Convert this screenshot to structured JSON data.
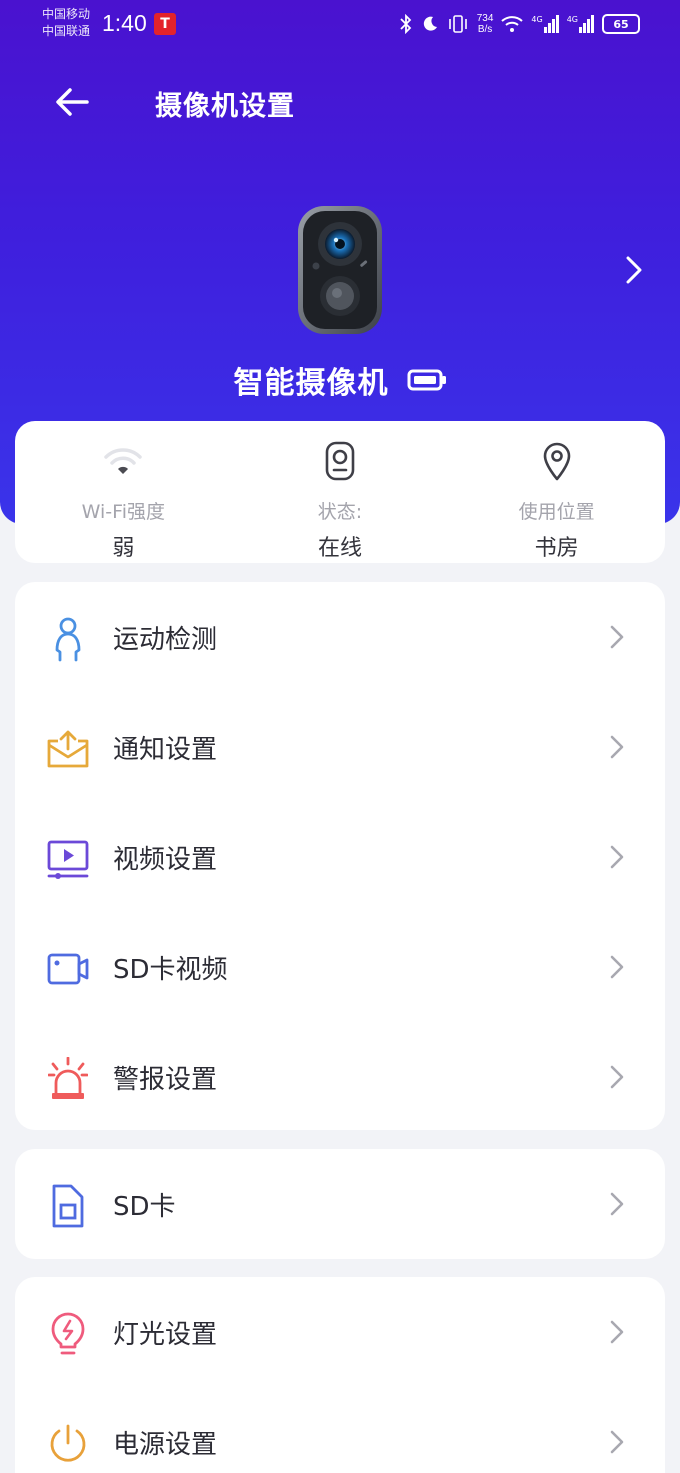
{
  "status_bar": {
    "carrier_1": "中国移动",
    "carrier_2": "中国联通",
    "time": "1:40",
    "net_speed_value": "734",
    "net_speed_unit": "B/s",
    "signal_1_label": "4G",
    "signal_2_label": "4G",
    "battery": "65"
  },
  "header": {
    "title": "摄像机设置",
    "back_icon": "arrow-left-icon"
  },
  "device": {
    "name": "智能摄像机",
    "battery_icon": "battery-icon"
  },
  "info": [
    {
      "label": "Wi-Fi强度",
      "value": "弱",
      "icon": "wifi-icon"
    },
    {
      "label": "状态:",
      "value": "在线",
      "icon": "camera-status-icon"
    },
    {
      "label": "使用位置",
      "value": "书房",
      "icon": "location-pin-icon"
    }
  ],
  "settings_group_1": [
    {
      "label": "运动检测",
      "icon": "person-icon",
      "color": "#4a90e2"
    },
    {
      "label": "通知设置",
      "icon": "mail-upload-icon",
      "color": "#e6a93a"
    },
    {
      "label": "视频设置",
      "icon": "video-monitor-icon",
      "color": "#6b49d8"
    },
    {
      "label": "SD卡视频",
      "icon": "video-camera-icon",
      "color": "#4f6be0"
    },
    {
      "label": "警报设置",
      "icon": "alarm-siren-icon",
      "color": "#ef5b5b"
    }
  ],
  "settings_group_2": [
    {
      "label": "SD卡",
      "icon": "sd-card-icon",
      "color": "#4f6be0"
    }
  ],
  "settings_group_3": [
    {
      "label": "灯光设置",
      "icon": "light-bulb-icon",
      "color": "#ef5b7d"
    },
    {
      "label": "电源设置",
      "icon": "power-icon",
      "color": "#e8a13a"
    }
  ],
  "colors": {
    "header_top": "#4a12cf",
    "header_bottom": "#3a34ea",
    "page_background": "#f2f3f7"
  }
}
